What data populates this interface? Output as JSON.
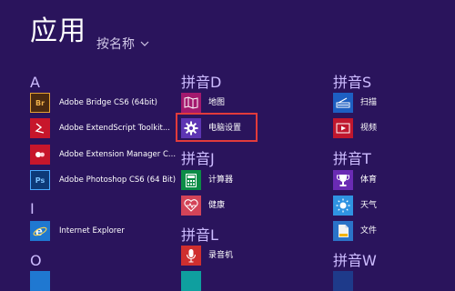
{
  "header": {
    "title": "应用",
    "sort_label": "按名称"
  },
  "groups": {
    "a": "A",
    "i": "I",
    "o": "O",
    "d": "拼音D",
    "j": "拼音J",
    "l": "拼音L",
    "s": "拼音S",
    "t": "拼音T",
    "w": "拼音W"
  },
  "apps": {
    "bridge": "Adobe Bridge CS6 (64bit)",
    "extendscript": "Adobe ExtendScript Toolkit...",
    "extension_manager": "Adobe Extension Manager C...",
    "photoshop": "Adobe Photoshop CS6 (64 Bit)",
    "ie": "Internet Explorer",
    "map": "地图",
    "pc_settings": "电脑设置",
    "calculator": "计算器",
    "health": "健康",
    "recorder": "录音机",
    "scan": "扫描",
    "video": "视频",
    "sports": "体育",
    "weather": "天气",
    "files": "文件"
  },
  "tiles": {
    "br": "Br",
    "ps": "Ps"
  },
  "colors": {
    "background": "#2a145c",
    "highlight": "#e23b3b"
  }
}
